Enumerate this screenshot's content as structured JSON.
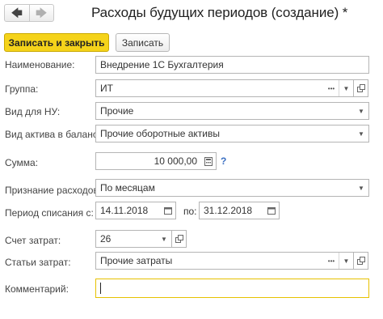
{
  "header": {
    "title": "Расходы будущих периодов (создание) *",
    "back_icon": "arrow-left-icon",
    "forward_icon": "arrow-right-icon"
  },
  "toolbar": {
    "save_close_label": "Записать и закрыть",
    "save_label": "Записать"
  },
  "form": {
    "name": {
      "label": "Наименование:",
      "value": "Внедрение 1С Бухгалтерия"
    },
    "group": {
      "label": "Группа:",
      "value": "ИТ"
    },
    "tax_type": {
      "label": "Вид для НУ:",
      "value": "Прочие"
    },
    "asset_type": {
      "label": "Вид актива в балансе:",
      "value": "Прочие оборотные активы"
    },
    "amount": {
      "label": "Сумма:",
      "value": "10 000,00",
      "help": "?"
    },
    "recognition": {
      "label": "Признание расходов:",
      "value": "По месяцам"
    },
    "period": {
      "label": "Период списания с:",
      "from": "14.11.2018",
      "to_label": "по:",
      "to": "31.12.2018"
    },
    "cost_account": {
      "label": "Счет затрат:",
      "value": "26"
    },
    "cost_items": {
      "label": "Статьи затрат:",
      "value": "Прочие затраты"
    },
    "comment": {
      "label": "Комментарий:",
      "value": ""
    }
  },
  "colors": {
    "primary_button": "#f5d31a",
    "focus_border": "#e7c100",
    "help": "#3a6fc2"
  }
}
